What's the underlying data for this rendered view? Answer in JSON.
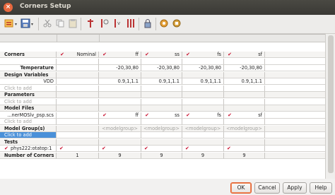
{
  "window": {
    "title": "Corners Setup"
  },
  "toolbar": {
    "icons": [
      "new-icon",
      "save-icon",
      "cut-icon",
      "copy-icon",
      "paste-icon",
      "import-icon",
      "export-icon",
      "add-variable-icon",
      "sweep-icon",
      "lock-icon",
      "run-icon",
      "settings-icon"
    ]
  },
  "header": {
    "corners": "Corners",
    "nominal": "Nominal",
    "corners_list": [
      "ff",
      "ss",
      "fs",
      "sf"
    ]
  },
  "rows": {
    "temperature": {
      "label": "Temperature",
      "values": [
        "-20,30,80",
        "-20,30,80",
        "-20,30,80",
        "-20,30,80"
      ]
    },
    "design_variables": "Design Variables",
    "vdd": {
      "label": "VDD",
      "values": [
        "0.9,1,1.1",
        "0.9,1,1.1",
        "0.9,1,1.1",
        "0.9,1,1.1"
      ]
    },
    "click_to_add": "Click to add",
    "parameters": "Parameters",
    "model_files": "Model Files",
    "model_file": {
      "label": "...nerMOSlv_psp.scs",
      "values": [
        "ff",
        "ss",
        "fs",
        "sf"
      ]
    },
    "model_groups": "Model Group(s)",
    "model_group_placeholder": "<modelgroup>",
    "tests": "Tests",
    "test": {
      "label": "phys222:otatop:1"
    },
    "number_of_corners": {
      "label": "Number of Corners",
      "nominal": "1",
      "values": [
        "9",
        "9",
        "9",
        "9"
      ]
    }
  },
  "buttons": {
    "ok": "OK",
    "cancel": "Cancel",
    "apply": "Apply",
    "help": "Help"
  },
  "colors": {
    "accent": "#e8683e",
    "check": "#c8102e",
    "selection": "#4a90d9"
  }
}
